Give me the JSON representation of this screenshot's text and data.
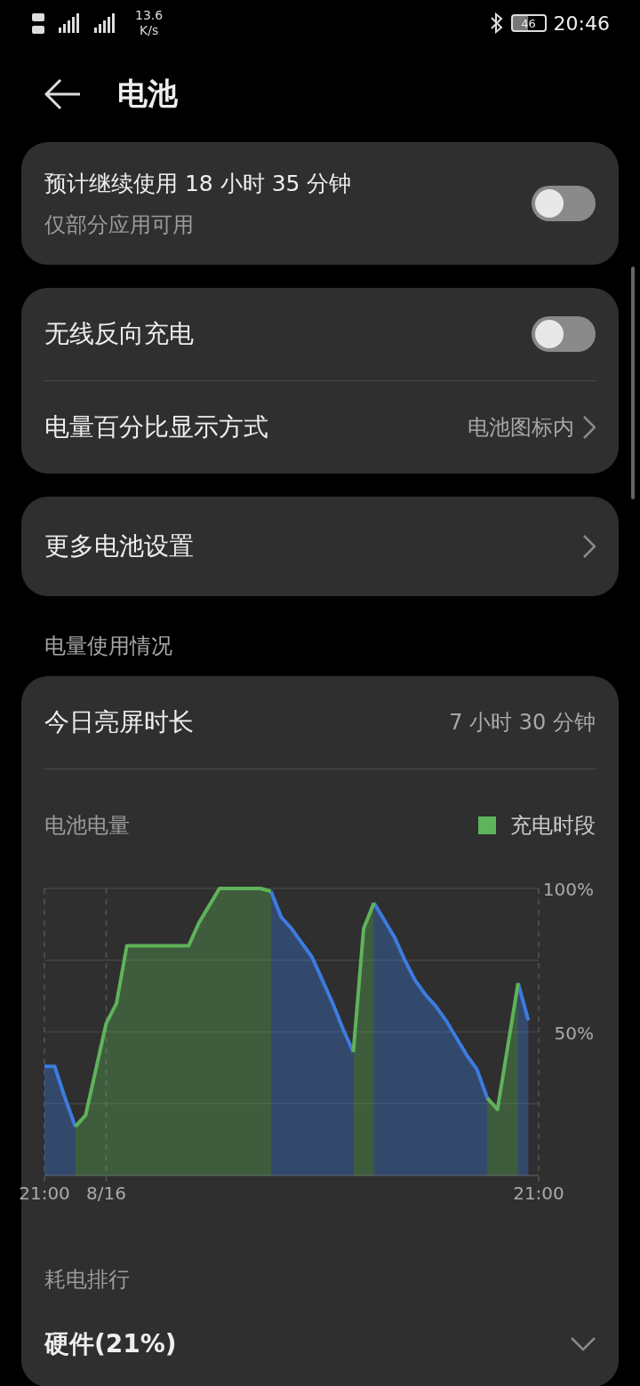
{
  "status_bar": {
    "network_speed": "13.6",
    "speed_unit": "K/s",
    "battery": "46",
    "time": "20:46"
  },
  "header": {
    "title": "电池"
  },
  "power_saving_card": {
    "estimate": "预计继续使用 18 小时 35 分钟",
    "note": "仅部分应用可用",
    "on": false
  },
  "settings_card": [
    {
      "kind": "toggle",
      "label": "无线反向充电",
      "on": false
    },
    {
      "kind": "link",
      "label": "电量百分比显示方式",
      "value": "电池图标内"
    }
  ],
  "more_card": {
    "label": "更多电池设置"
  },
  "usage": {
    "section_title": "电量使用情况",
    "screen_time_label": "今日亮屏时长",
    "screen_time": "7 小时 30 分钟",
    "chart_data": {
      "type": "area",
      "title": "电池电量",
      "categories": [
        "21:00",
        null,
        null,
        null,
        null,
        null,
        "8/16",
        null,
        null,
        null,
        null,
        null,
        null,
        null,
        null,
        null,
        null,
        null,
        null,
        null,
        null,
        null,
        null,
        null,
        null,
        null,
        null,
        null,
        null,
        null,
        null,
        null,
        null,
        null,
        null,
        null,
        null,
        null,
        null,
        null,
        null,
        null,
        null,
        null,
        null,
        null,
        null,
        null,
        "21:00"
      ],
      "series": [
        {
          "color": "#3d7be0",
          "values": [
            38,
            38,
            27,
            17,
            null,
            null,
            null,
            null,
            null,
            null,
            null,
            null,
            null,
            null,
            null,
            null,
            null,
            null,
            null,
            null,
            null,
            null,
            99,
            90,
            86,
            81,
            76,
            68,
            60,
            51,
            43,
            null,
            95,
            89,
            83,
            75,
            68,
            63,
            59,
            54,
            48,
            42,
            37,
            27,
            null,
            null,
            67,
            54,
            null
          ]
        },
        {
          "name": "充电时段",
          "color": "#5fb35a",
          "values": [
            null,
            null,
            null,
            17,
            21,
            37,
            53,
            60,
            80,
            80,
            80,
            80,
            80,
            80,
            80,
            88,
            94,
            100,
            100,
            100,
            100,
            100,
            99,
            null,
            null,
            null,
            null,
            null,
            null,
            null,
            43,
            86,
            95,
            null,
            null,
            null,
            null,
            null,
            null,
            null,
            null,
            null,
            null,
            27,
            23,
            45,
            67,
            null,
            null
          ]
        }
      ],
      "ylim": [
        0,
        100
      ],
      "yticks": [
        {
          "value": 50,
          "label": "50%"
        },
        {
          "value": 100,
          "label": "100%"
        }
      ]
    },
    "ranking_title": "耗电排行",
    "ranking_items": [
      {
        "label": "硬件(21%)",
        "expanded": false
      }
    ]
  }
}
